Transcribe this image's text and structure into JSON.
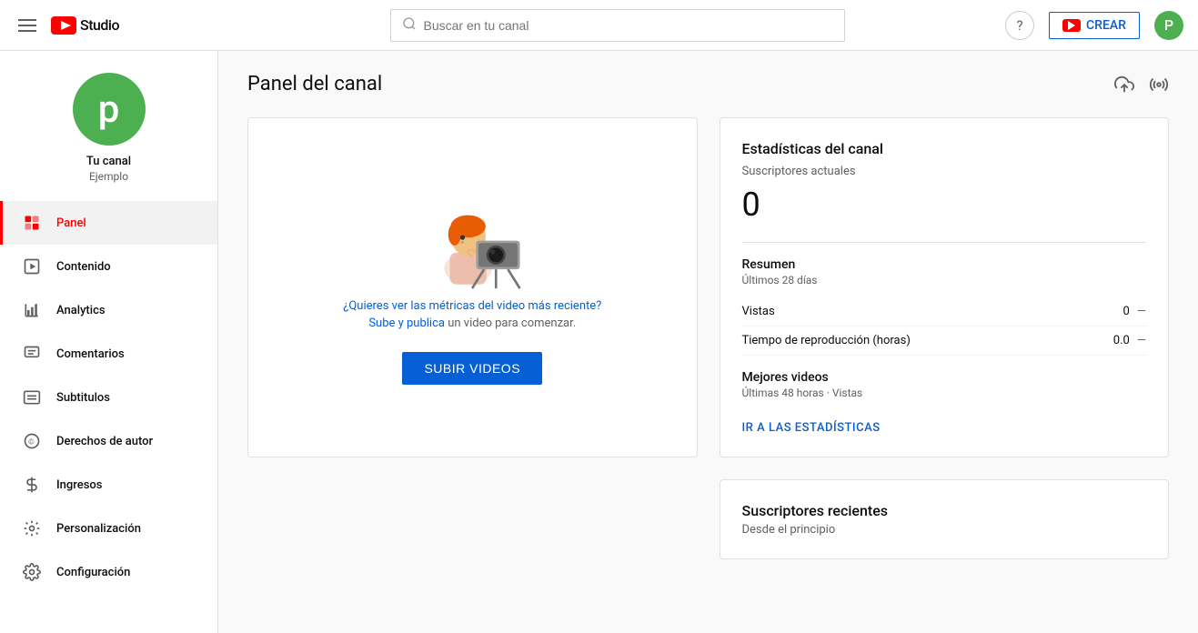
{
  "header": {
    "menu_icon": "hamburger-icon",
    "logo_text": "Studio",
    "search_placeholder": "Buscar en tu canal",
    "help_label": "?",
    "create_label": "CREAR",
    "avatar_letter": "P"
  },
  "sidebar": {
    "channel_avatar_letter": "p",
    "channel_name": "Tu canal",
    "channel_subtitle": "Ejemplo",
    "items": [
      {
        "id": "panel",
        "label": "Panel",
        "active": true
      },
      {
        "id": "contenido",
        "label": "Contenido",
        "active": false
      },
      {
        "id": "analytics",
        "label": "Analytics",
        "active": false
      },
      {
        "id": "comentarios",
        "label": "Comentarios",
        "active": false
      },
      {
        "id": "subtitulos",
        "label": "Subtitulos",
        "active": false
      },
      {
        "id": "derechos",
        "label": "Derechos de autor",
        "active": false
      },
      {
        "id": "ingresos",
        "label": "Ingresos",
        "active": false
      },
      {
        "id": "personalizacion",
        "label": "Personalización",
        "active": false
      },
      {
        "id": "configuracion",
        "label": "Configuración",
        "active": false
      }
    ]
  },
  "main": {
    "page_title": "Panel del canal",
    "upload_card": {
      "text_line1": "¿Quieres ver las métricas del video más reciente?",
      "text_line2": "Sube y publica un video para comenzar.",
      "button_label": "SUBIR VIDEOS"
    },
    "stats_card": {
      "title": "Estadísticas del canal",
      "subscribers_label": "Suscriptores actuales",
      "subscribers_count": "0",
      "summary_title": "Resumen",
      "summary_period": "Últimos 28 días",
      "rows": [
        {
          "label": "Vistas",
          "value": "0",
          "dash": "—"
        },
        {
          "label": "Tiempo de reproducción (horas)",
          "value": "0.0",
          "dash": "—"
        }
      ],
      "best_videos_title": "Mejores videos",
      "best_videos_subtitle": "Últimas 48 horas · Vistas",
      "go_stats_label": "IR A LAS ESTADÍSTICAS"
    },
    "subscribers_card": {
      "title": "Suscriptores recientes",
      "subtitle": "Desde el principio"
    }
  }
}
